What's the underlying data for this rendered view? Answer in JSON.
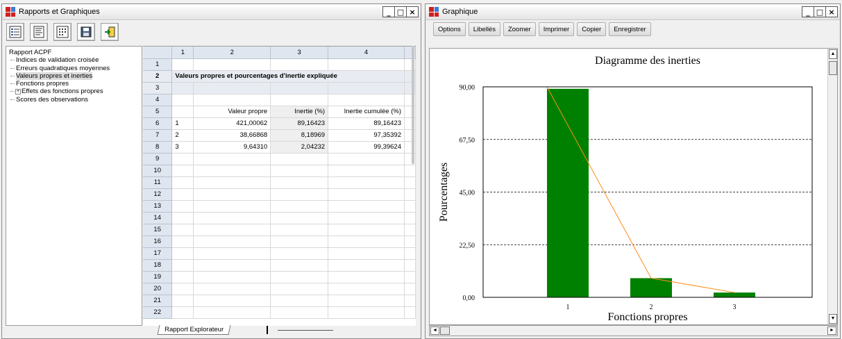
{
  "window_left": {
    "title": "Rapports et Graphiques",
    "toolbar_icons": [
      "tree-view-icon",
      "report-view-icon",
      "grid-dots-icon",
      "save-icon",
      "exit-icon"
    ],
    "tree": {
      "root": "Rapport ACPF",
      "items": [
        "Indices de validation croisée",
        "Erreurs quadratiques moyennes",
        "Valeurs propres et inerties",
        "Fonctions propres",
        "Effets des fonctions propres",
        "Scores des observations"
      ],
      "selected_index": 2
    },
    "grid": {
      "col_headers": [
        "",
        "1",
        "2",
        "3",
        "4"
      ],
      "title": "Valeurs propres et pourcentages d'inertie expliquée",
      "headers": [
        "Valeur propre",
        "Inertie (%)",
        "Inertie cumulée (%)"
      ],
      "rows": [
        [
          "1",
          "421,00062",
          "89,16423",
          "89,16423"
        ],
        [
          "2",
          "38,66868",
          "8,18969",
          "97,35392"
        ],
        [
          "3",
          "9,64310",
          "2,04232",
          "99,39624"
        ]
      ],
      "row_numbers": [
        "1",
        "2",
        "3",
        "4",
        "5",
        "6",
        "7",
        "8",
        "9",
        "10",
        "11",
        "12",
        "13",
        "14",
        "15",
        "16",
        "17",
        "18",
        "19",
        "20",
        "21",
        "22"
      ]
    },
    "tab_label": "Rapport Explorateur"
  },
  "window_right": {
    "title": "Graphique",
    "buttons": [
      "Options",
      "Libellés",
      "Zoomer",
      "Imprimer",
      "Copier",
      "Enregistrer"
    ]
  },
  "chart_data": {
    "type": "bar",
    "title": "Diagramme des inerties",
    "xlabel": "Fonctions propres",
    "ylabel": "Pourcentages",
    "categories": [
      "1",
      "2",
      "3"
    ],
    "values": [
      89.16,
      8.19,
      2.04
    ],
    "ylim": [
      0,
      90
    ],
    "yticks": [
      "0,00",
      "22,50",
      "45,00",
      "67,50",
      "90,00"
    ],
    "bar_color": "#008000",
    "line_color": "#ff8c1a",
    "grid": "horizontal dashed"
  }
}
